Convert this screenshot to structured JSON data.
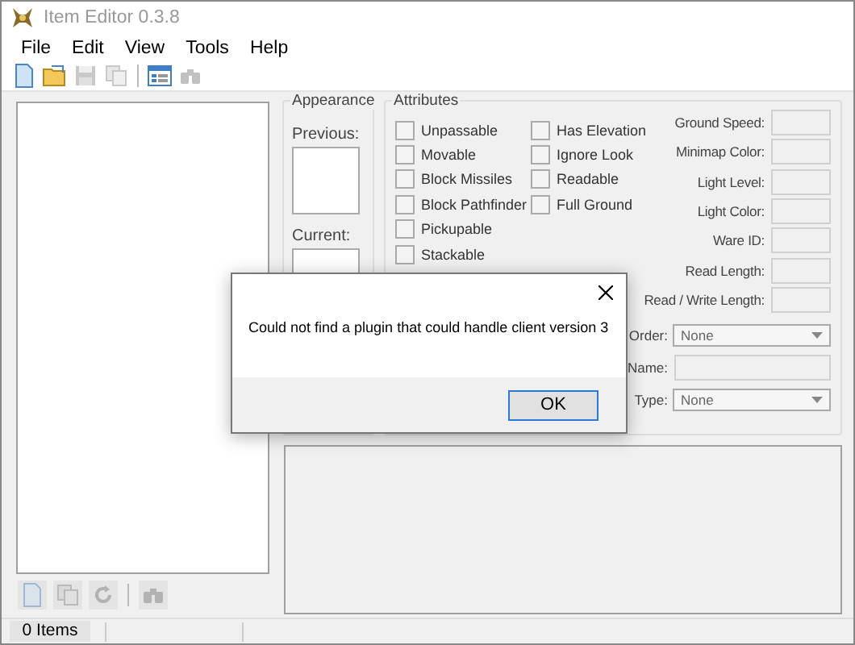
{
  "window": {
    "title": "Item Editor 0.3.8"
  },
  "menu": [
    "File",
    "Edit",
    "View",
    "Tools",
    "Help"
  ],
  "toolbar": [
    {
      "kind": "new",
      "disabled": false
    },
    {
      "kind": "open",
      "disabled": false
    },
    {
      "kind": "save",
      "disabled": true
    },
    {
      "kind": "copy",
      "disabled": true
    },
    {
      "kind": "separator"
    },
    {
      "kind": "window",
      "disabled": false
    },
    {
      "kind": "find",
      "disabled": true
    }
  ],
  "appearance": {
    "title": "Appearance",
    "previous_label": "Previous:",
    "current_label": "Current:"
  },
  "attributes": {
    "title": "Attributes",
    "checkboxes_left": [
      {
        "label": "Unpassable",
        "checked": false
      },
      {
        "label": "Movable",
        "checked": false
      },
      {
        "label": "Block Missiles",
        "checked": false
      },
      {
        "label": "Block Pathfinder",
        "checked": false
      },
      {
        "label": "Pickupable",
        "checked": false
      },
      {
        "label": "Stackable",
        "checked": false
      }
    ],
    "checkboxes_right": [
      {
        "label": "Has Elevation",
        "checked": false
      },
      {
        "label": "Ignore Look",
        "checked": false
      },
      {
        "label": "Readable",
        "checked": false
      },
      {
        "label": "Full Ground",
        "checked": false
      }
    ],
    "fields": [
      "Ground Speed:",
      "Minimap Color:",
      "Light Level:",
      "Light Color:",
      "Ware ID:",
      "Read Length:",
      "Read / Write Length:"
    ],
    "selectors": [
      {
        "kind": "dropdown",
        "label": "Order:",
        "value": "None"
      },
      {
        "kind": "text",
        "label": "Name:"
      },
      {
        "kind": "dropdown",
        "label": "Type:",
        "value": "None"
      }
    ]
  },
  "list_toolbar": [
    {
      "kind": "new",
      "disabled": true
    },
    {
      "kind": "copy",
      "disabled": true
    },
    {
      "kind": "reload",
      "disabled": true
    },
    {
      "kind": "separator"
    },
    {
      "kind": "find",
      "disabled": true
    }
  ],
  "status_bar": {
    "count": "0 Items"
  },
  "dialog": {
    "message": "Could not find a plugin that could handle client version 3",
    "button": "OK"
  }
}
